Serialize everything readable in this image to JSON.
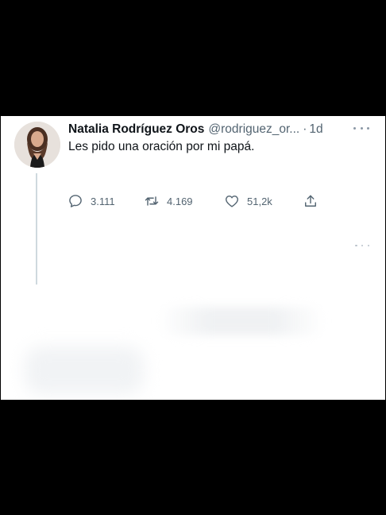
{
  "tweet": {
    "author_name": "Natalia Rodríguez Oros",
    "handle": "@rodriguez_or...",
    "separator": "·",
    "time": "1d",
    "text": "Les pido una oración por mi papá.",
    "avatar": "avatar-photo",
    "more_icon": "more-dots-icon"
  },
  "actions": {
    "reply": {
      "icon": "reply-icon",
      "count": "3.111"
    },
    "retweet": {
      "icon": "retweet-icon",
      "count": "4.169"
    },
    "like": {
      "icon": "heart-icon",
      "count": "51,2k"
    },
    "share": {
      "icon": "share-icon"
    }
  },
  "colors": {
    "background": "#000000",
    "card": "#ffffff",
    "text": "#0f1419",
    "secondary": "#536471"
  }
}
